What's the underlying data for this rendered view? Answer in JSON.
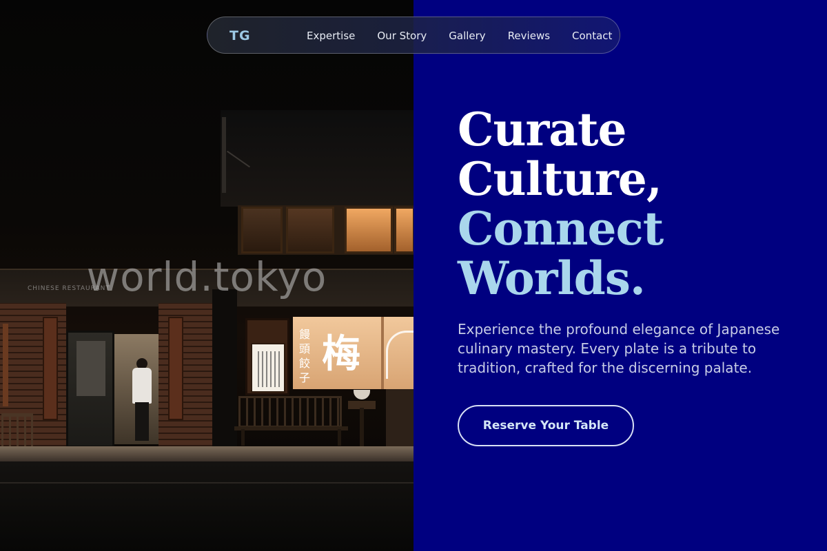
{
  "nav": {
    "logo": "TG",
    "links": [
      "Expertise",
      "Our Story",
      "Gallery",
      "Reviews",
      "Contact"
    ]
  },
  "photo": {
    "watermark": "world.tokyo",
    "store_sign": "CHINESE RESTAURANT",
    "noren_glyph": "梅",
    "noren_small": "饅頭餃子"
  },
  "hero": {
    "headline": {
      "line1": "Curate",
      "line2": "Culture,",
      "line3": "Connect",
      "line4": "Worlds."
    },
    "lede": "Experience the profound elegance of Japanese culinary mastery. Every plate is a tribute to tradition, crafted for the discerning palate.",
    "cta_label": "Reserve Your Table"
  },
  "colors": {
    "hero_background": "#000080",
    "headline_white": "#ffffff",
    "headline_accent": "#a9d6ec",
    "logo": "#9cc8e4",
    "lede": "#c8cde6"
  }
}
